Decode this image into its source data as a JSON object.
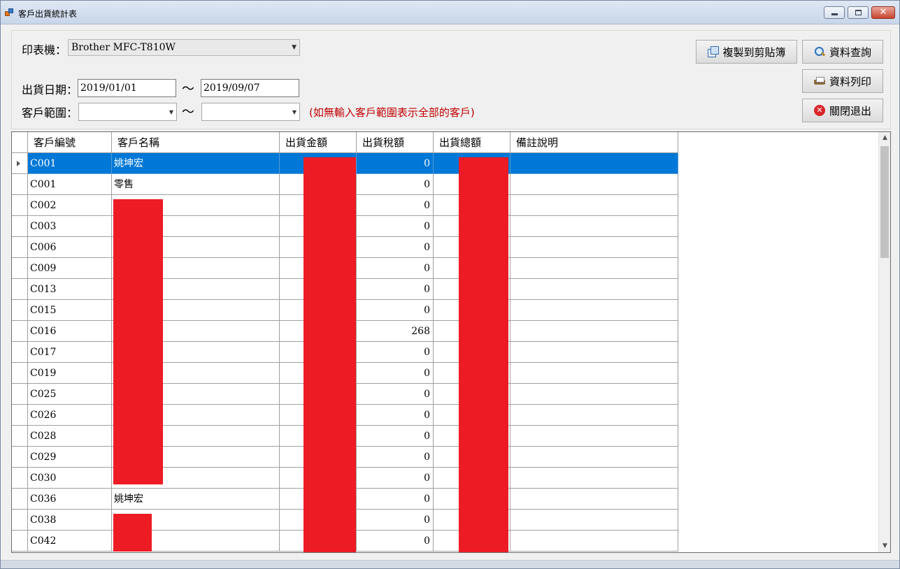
{
  "window": {
    "title": "客戶出貨統計表"
  },
  "filters": {
    "printer_label": "印表機：",
    "printer_value": "Brother MFC-T810W",
    "date_label": "出貨日期：",
    "date_from": "2019/01/01",
    "date_to": "2019/09/07",
    "range_label": "客戶範圍：",
    "range_from": "",
    "range_to": "",
    "tilde": "～",
    "range_hint": "(如無輸入客戶範圍表示全部的客戶)"
  },
  "buttons": {
    "copy": "複製到剪貼簿",
    "query": "資料查詢",
    "print": "資料列印",
    "exit": "關閉退出"
  },
  "grid": {
    "columns": [
      "客戶編號",
      "客戶名稱",
      "出貨金額",
      "出貨稅額",
      "出貨總額",
      "備註說明"
    ],
    "selected_row": 0,
    "rows": [
      {
        "code": "C001",
        "name": "姚坤宏",
        "tax": "0"
      },
      {
        "code": "C001",
        "name": "零售",
        "tax": "0"
      },
      {
        "code": "C002",
        "name": "",
        "tax": "0"
      },
      {
        "code": "C003",
        "name": "",
        "tax": "0"
      },
      {
        "code": "C006",
        "name": "",
        "tax": "0"
      },
      {
        "code": "C009",
        "name": "",
        "tax": "0"
      },
      {
        "code": "C013",
        "name": "",
        "tax": "0"
      },
      {
        "code": "C015",
        "name": "",
        "tax": "0"
      },
      {
        "code": "C016",
        "name": "",
        "tax": "268"
      },
      {
        "code": "C017",
        "name": "",
        "tax": "0"
      },
      {
        "code": "C019",
        "name": "",
        "tax": "0"
      },
      {
        "code": "C025",
        "name": "",
        "tax": "0"
      },
      {
        "code": "C026",
        "name": "",
        "tax": "0"
      },
      {
        "code": "C028",
        "name": "",
        "tax": "0"
      },
      {
        "code": "C029",
        "name": "",
        "tax": "0"
      },
      {
        "code": "C030",
        "name": "",
        "tax": "0"
      },
      {
        "code": "C036",
        "name": "姚坤宏",
        "tax": "0"
      },
      {
        "code": "C038",
        "name": "",
        "tax": "0"
      },
      {
        "code": "C042",
        "name": "",
        "tax": "0"
      }
    ]
  },
  "colors": {
    "selection": "#0078d7",
    "redaction": "#ed1c24",
    "hint_text": "#c00000"
  }
}
